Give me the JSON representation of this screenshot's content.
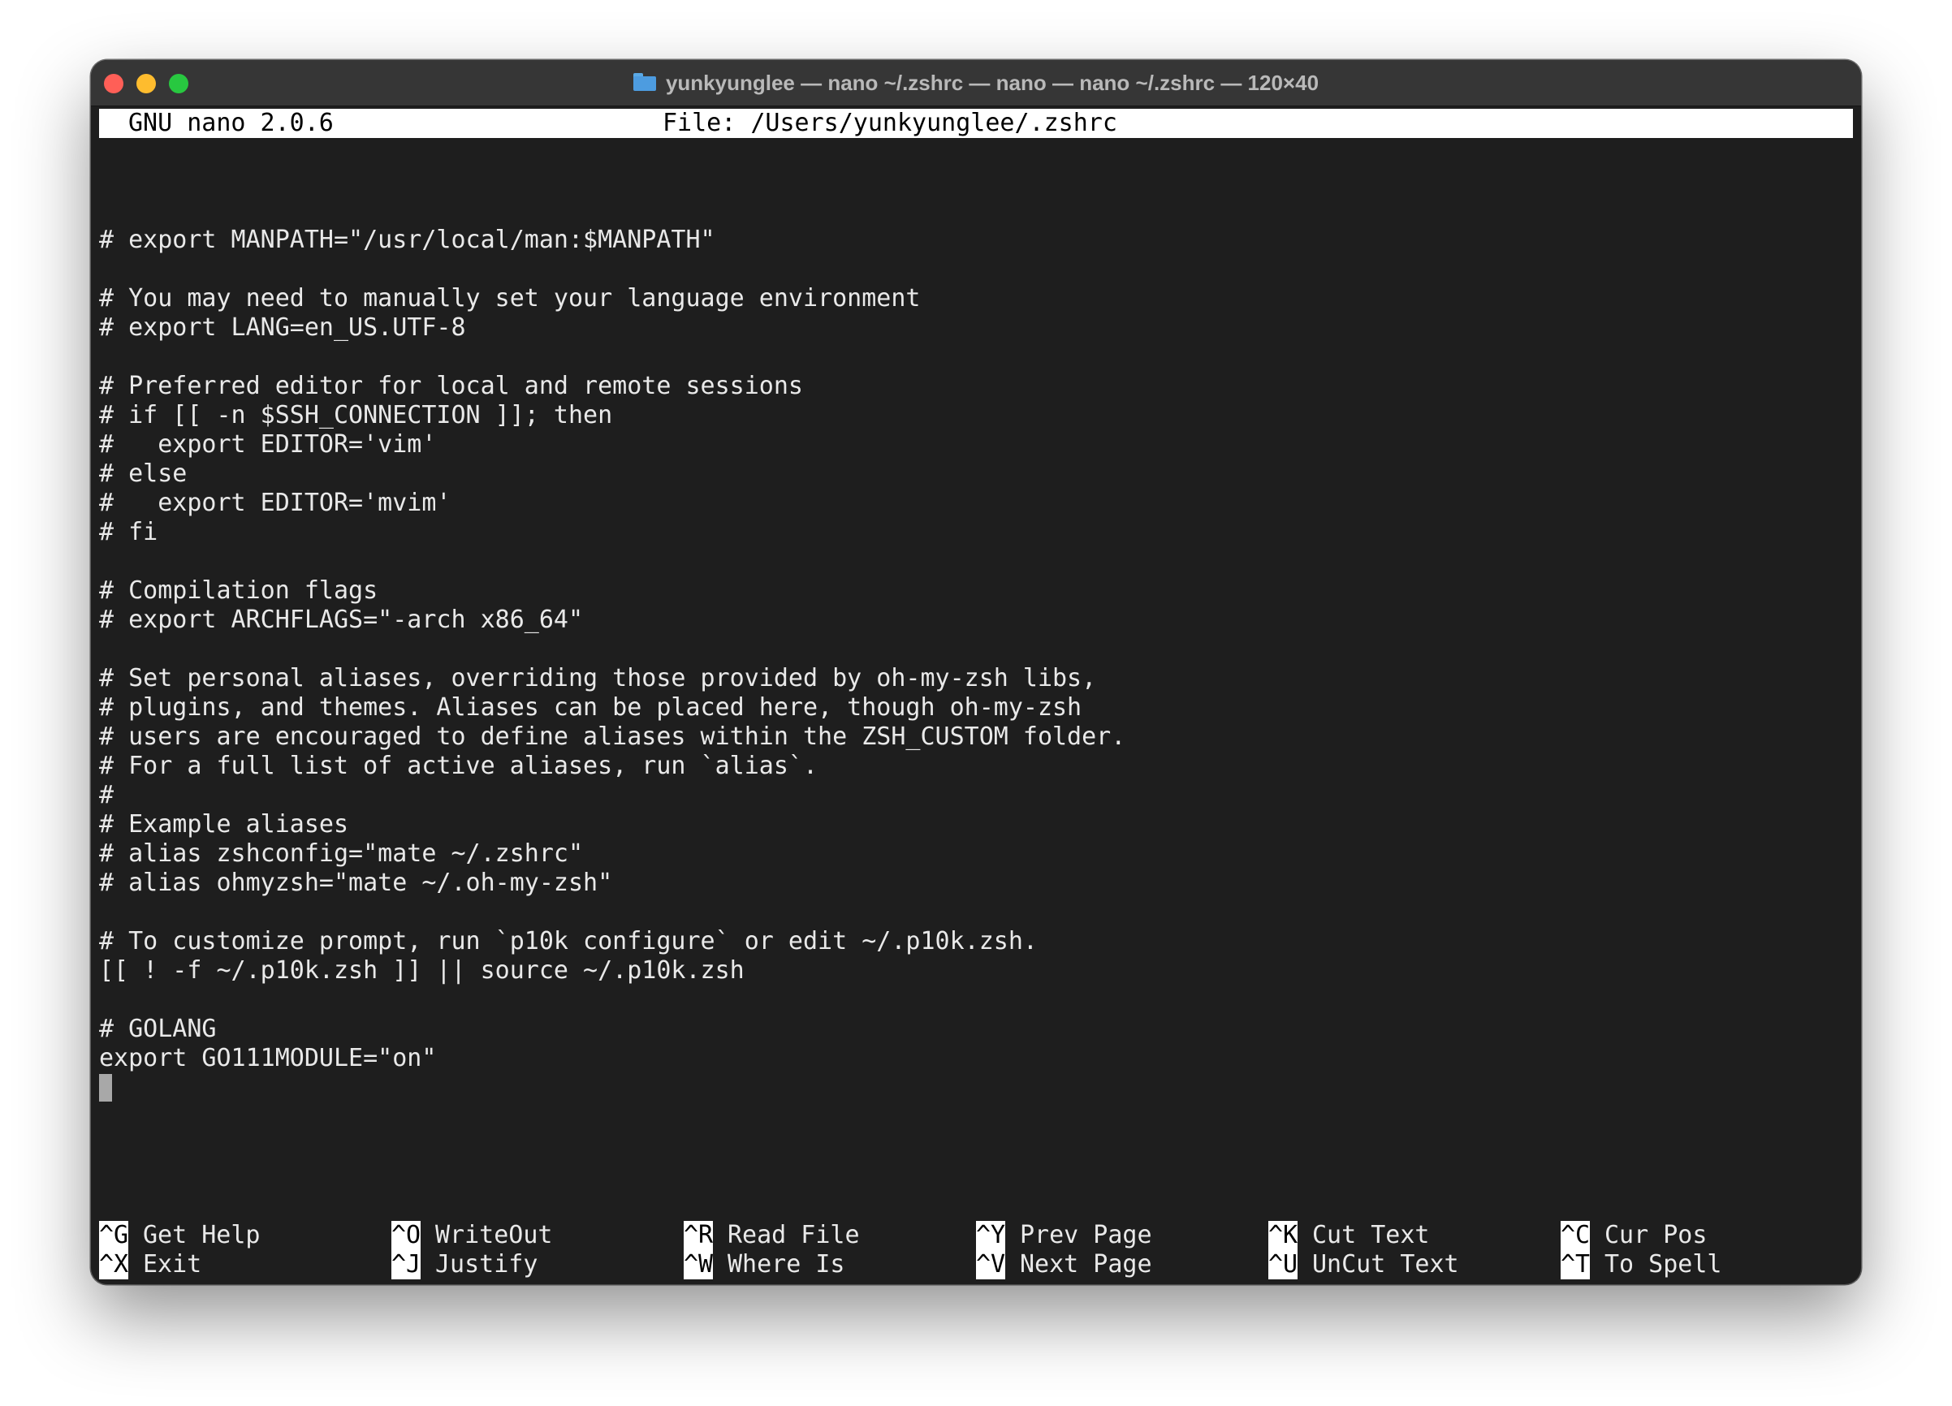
{
  "window": {
    "title": "yunkyunglee — nano ~/.zshrc — nano — nano ~/.zshrc — 120×40",
    "title_icon": "folder-icon",
    "traffic_colors": {
      "close": "#ff5f57",
      "minimize": "#febc2e",
      "maximize": "#28c840"
    }
  },
  "nano": {
    "version": "GNU nano 2.0.6",
    "file": "File: /Users/yunkyunglee/.zshrc"
  },
  "editor": {
    "lines": [
      "# export MANPATH=\"/usr/local/man:$MANPATH\"",
      "",
      "# You may need to manually set your language environment",
      "# export LANG=en_US.UTF-8",
      "",
      "# Preferred editor for local and remote sessions",
      "# if [[ -n $SSH_CONNECTION ]]; then",
      "#   export EDITOR='vim'",
      "# else",
      "#   export EDITOR='mvim'",
      "# fi",
      "",
      "# Compilation flags",
      "# export ARCHFLAGS=\"-arch x86_64\"",
      "",
      "# Set personal aliases, overriding those provided by oh-my-zsh libs,",
      "# plugins, and themes. Aliases can be placed here, though oh-my-zsh",
      "# users are encouraged to define aliases within the ZSH_CUSTOM folder.",
      "# For a full list of active aliases, run `alias`.",
      "#",
      "# Example aliases",
      "# alias zshconfig=\"mate ~/.zshrc\"",
      "# alias ohmyzsh=\"mate ~/.oh-my-zsh\"",
      "",
      "# To customize prompt, run `p10k configure` or edit ~/.p10k.zsh.",
      "[[ ! -f ~/.p10k.zsh ]] || source ~/.p10k.zsh",
      "",
      "# GOLANG",
      "export GO111MODULE=\"on\""
    ]
  },
  "shortcuts": [
    {
      "top": {
        "key": "^G",
        "label": "Get Help"
      },
      "bottom": {
        "key": "^X",
        "label": "Exit"
      }
    },
    {
      "top": {
        "key": "^O",
        "label": "WriteOut"
      },
      "bottom": {
        "key": "^J",
        "label": "Justify"
      }
    },
    {
      "top": {
        "key": "^R",
        "label": "Read File"
      },
      "bottom": {
        "key": "^W",
        "label": "Where Is"
      }
    },
    {
      "top": {
        "key": "^Y",
        "label": "Prev Page"
      },
      "bottom": {
        "key": "^V",
        "label": "Next Page"
      }
    },
    {
      "top": {
        "key": "^K",
        "label": "Cut Text"
      },
      "bottom": {
        "key": "^U",
        "label": "UnCut Text"
      }
    },
    {
      "top": {
        "key": "^C",
        "label": "Cur Pos"
      },
      "bottom": {
        "key": "^T",
        "label": "To Spell"
      }
    }
  ]
}
